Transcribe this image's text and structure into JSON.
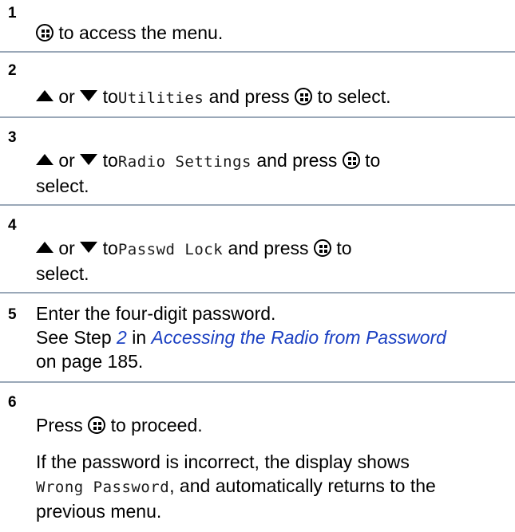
{
  "steps": [
    {
      "number": "1",
      "line": "to access the menu."
    },
    {
      "number": "2",
      "or": "or",
      "to": "to",
      "menu": "Utilities",
      "press": "and press",
      "tail": "to select."
    },
    {
      "number": "3",
      "or": "or",
      "to": "to",
      "menu": "Radio Settings",
      "press": "and press",
      "tail": "to",
      "tail2": "select."
    },
    {
      "number": "4",
      "or": "or",
      "to": "to",
      "menu": "Passwd Lock",
      "press": "and press",
      "tail": "to",
      "tail2": "select."
    },
    {
      "number": "5",
      "line1": "Enter the four-digit password.",
      "see": "See Step",
      "step_link": "2",
      "in": "in",
      "section_link": "Accessing the Radio from Password",
      "page_ref": "on page 185."
    },
    {
      "number": "6",
      "press": "Press",
      "tail": "to proceed.",
      "note_prefix": "If the password is incorrect, the display shows",
      "note_mono": "Wrong Password",
      "note_suffix": ", and automatically returns to the",
      "note_end": "previous menu."
    }
  ],
  "icons": {
    "menu_ok": "menu-ok-button-icon",
    "up": "up-arrow-icon",
    "down": "down-arrow-icon"
  }
}
